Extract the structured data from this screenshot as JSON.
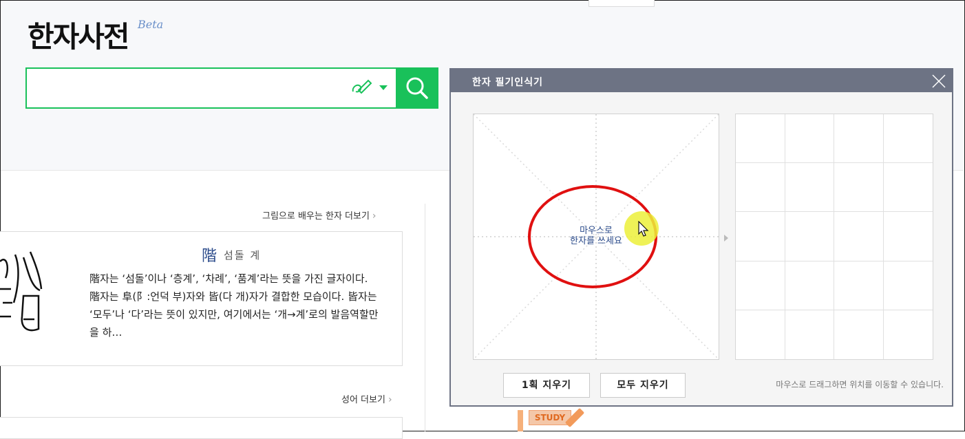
{
  "header": {
    "logo": "한자사전",
    "beta": "Beta",
    "search": {
      "value": "",
      "placeholder": ""
    },
    "handwrite_icon": "handwriting-icon",
    "search_icon": "search-icon"
  },
  "content": {
    "picture_section": {
      "more_link": "그림으로 배우는 한자 더보기",
      "hanja": "階",
      "meaning": "섬돌 계",
      "description": "階자는 ‘섬돌’이나 ‘층계’, ‘차례’, ‘품계’라는 뜻을 가진 글자이다. 階자는 阜(阝:언덕 부)자와 皆(다 개)자가 결합한 모습이다. 皆자는 ‘모두’나 ‘다’라는 뜻이 있지만, 여기에서는 ‘개→계’로의 발음역할만을 하…"
    },
    "idiom_section": {
      "more_link": "성어 더보기"
    },
    "study_badge": "STUDY"
  },
  "dialog": {
    "title": "한자 필기인식기",
    "canvas_hint_line1": "마우스로",
    "canvas_hint_line2": "한자를 쓰세요",
    "erase_one": "1획 지우기",
    "erase_all": "모두 지우기",
    "drag_hint": "마우스로 드래그하면 위치를 이동할 수 있습니다.",
    "close_icon": "close-icon"
  },
  "colors": {
    "accent": "#19c15a",
    "dialog_header": "#6d7384",
    "annotation": "#e01010",
    "hanja_blue": "#2a4a8a"
  }
}
